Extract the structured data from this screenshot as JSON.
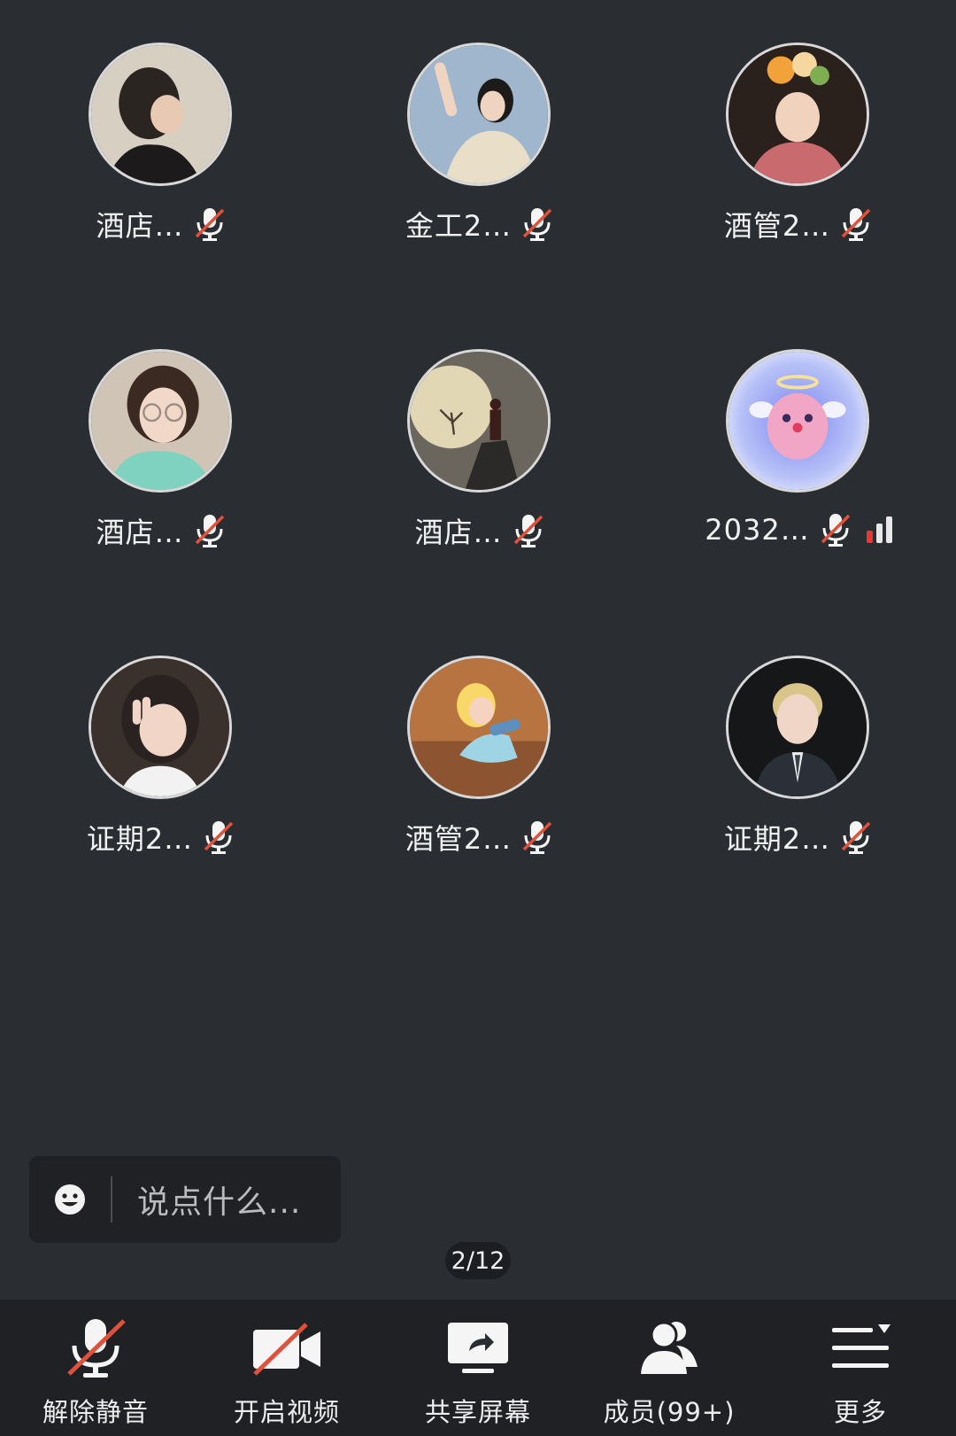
{
  "participants": [
    {
      "name": "酒店…",
      "avatar": "avatar-dark-hair-girl",
      "mic": "muted"
    },
    {
      "name": "金工2…",
      "avatar": "avatar-girl-sky",
      "mic": "muted"
    },
    {
      "name": "酒管2…",
      "avatar": "avatar-girl-flowers",
      "mic": "muted"
    },
    {
      "name": "酒店…",
      "avatar": "avatar-girl-glasses",
      "mic": "muted"
    },
    {
      "name": "酒店…",
      "avatar": "avatar-samurai-moon",
      "mic": "muted"
    },
    {
      "name": "2032…",
      "avatar": "avatar-pink-angel",
      "mic": "muted",
      "signal": "weak"
    },
    {
      "name": "证期2…",
      "avatar": "avatar-girl-peace-sign",
      "mic": "muted"
    },
    {
      "name": "酒管2…",
      "avatar": "avatar-cartoon-princess",
      "mic": "muted"
    },
    {
      "name": "证期2…",
      "avatar": "avatar-blond-boy",
      "mic": "muted"
    }
  ],
  "chat": {
    "placeholder": "说点什么..."
  },
  "pager": {
    "text": "2/12"
  },
  "toolbar": {
    "unmute": "解除静音",
    "video": "开启视频",
    "share": "共享屏幕",
    "members": "成员(99+)",
    "more": "更多"
  },
  "colors": {
    "background": "#2a2d32",
    "muted_slash": "#e0513b",
    "signal_weak": "#e53935"
  }
}
